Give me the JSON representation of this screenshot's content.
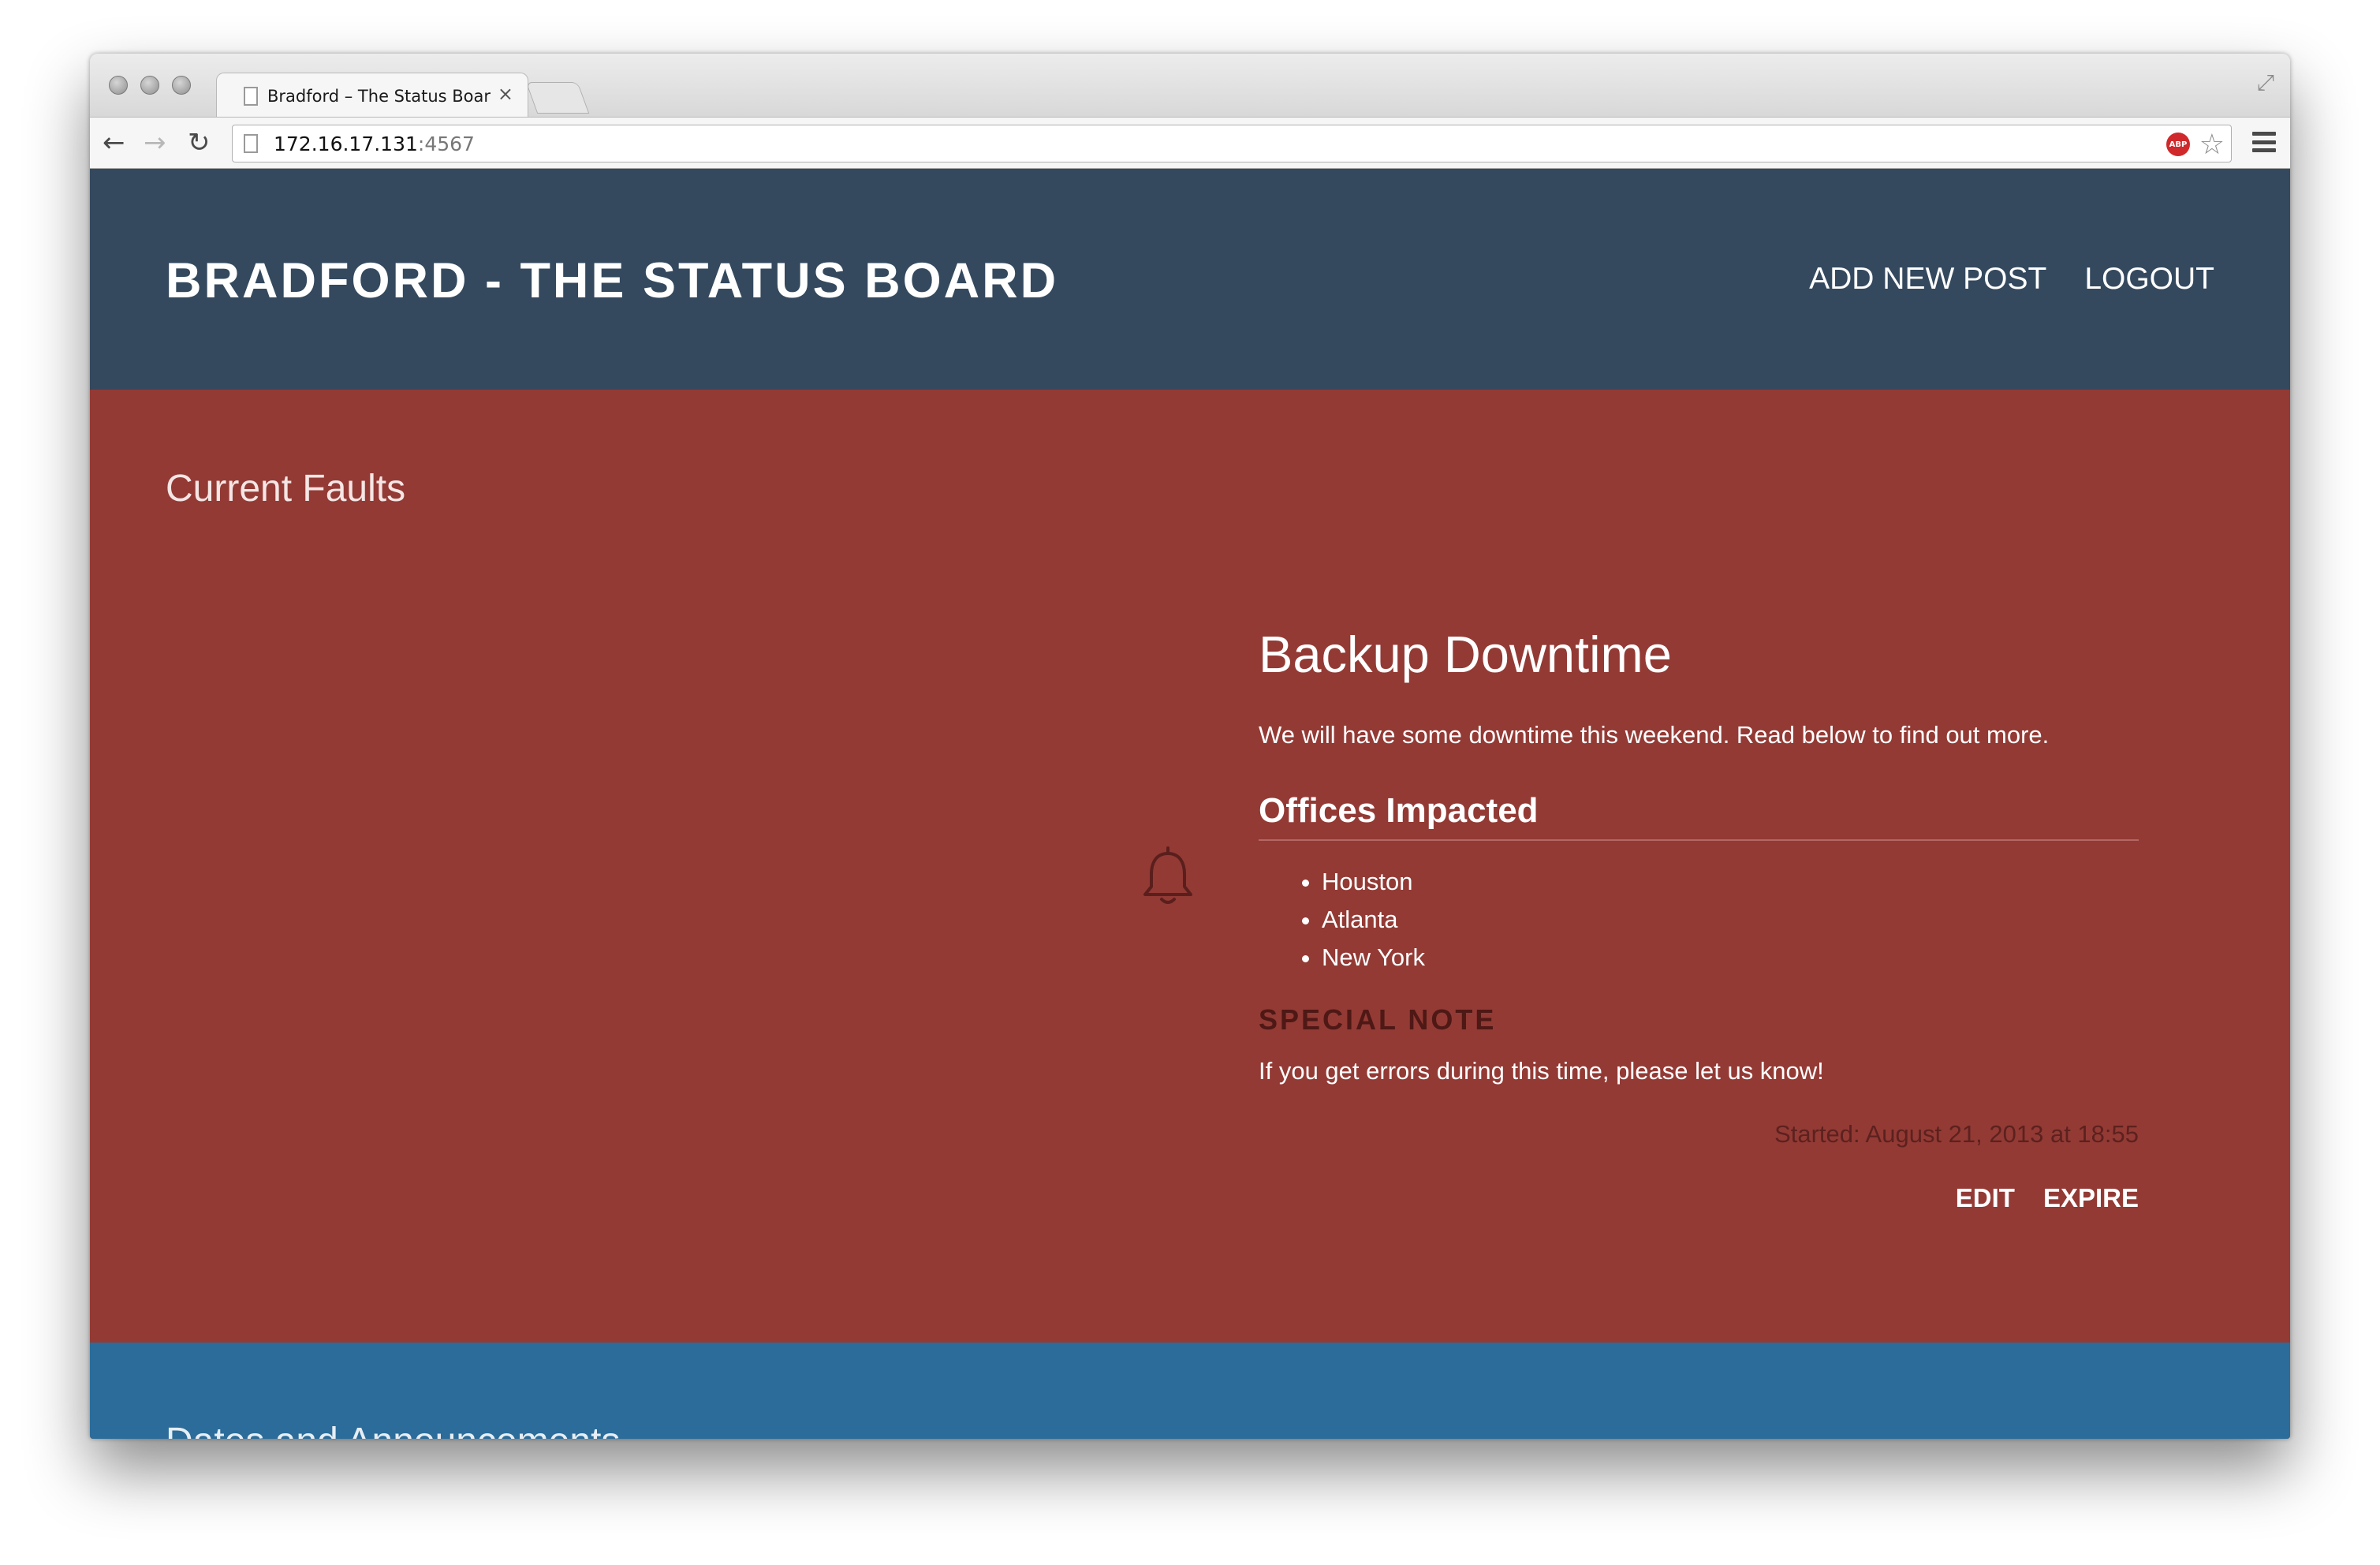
{
  "browser": {
    "tab_title": "Bradford – The Status Boar",
    "tab_close": "×",
    "url_host": "172.16.17.131",
    "url_port": ":4567",
    "abp_label": "ABP"
  },
  "icons": {
    "back": "arrow-left-icon",
    "forward": "arrow-right-icon",
    "reload": "reload-icon",
    "star": "star-icon",
    "menu": "hamburger-menu-icon",
    "bell": "bell-icon",
    "fullscreen": "fullscreen-icon"
  },
  "colors": {
    "header_bg": "#34495e",
    "faults_bg": "#933a35",
    "notes_bg": "#2b6c9a"
  },
  "header": {
    "title": "BRADFORD - THE STATUS BOARD",
    "nav": {
      "add_new_post": "ADD NEW POST",
      "logout": "LOGOUT"
    }
  },
  "faults": {
    "heading": "Current Faults",
    "post": {
      "title": "Backup Downtime",
      "summary": "We will have some downtime this weekend. Read below to find out more.",
      "offices_heading": "Offices Impacted",
      "offices": [
        "Houston",
        "Atlanta",
        "New York"
      ],
      "special_note_label": "SPECIAL NOTE",
      "special_note_text": "If you get errors during this time, please let us know!",
      "started": "Started: August 21, 2013 at 18:55",
      "actions": {
        "edit": "EDIT",
        "expire": "EXPIRE"
      }
    }
  },
  "notes": {
    "heading": "Dates and Announcements"
  }
}
